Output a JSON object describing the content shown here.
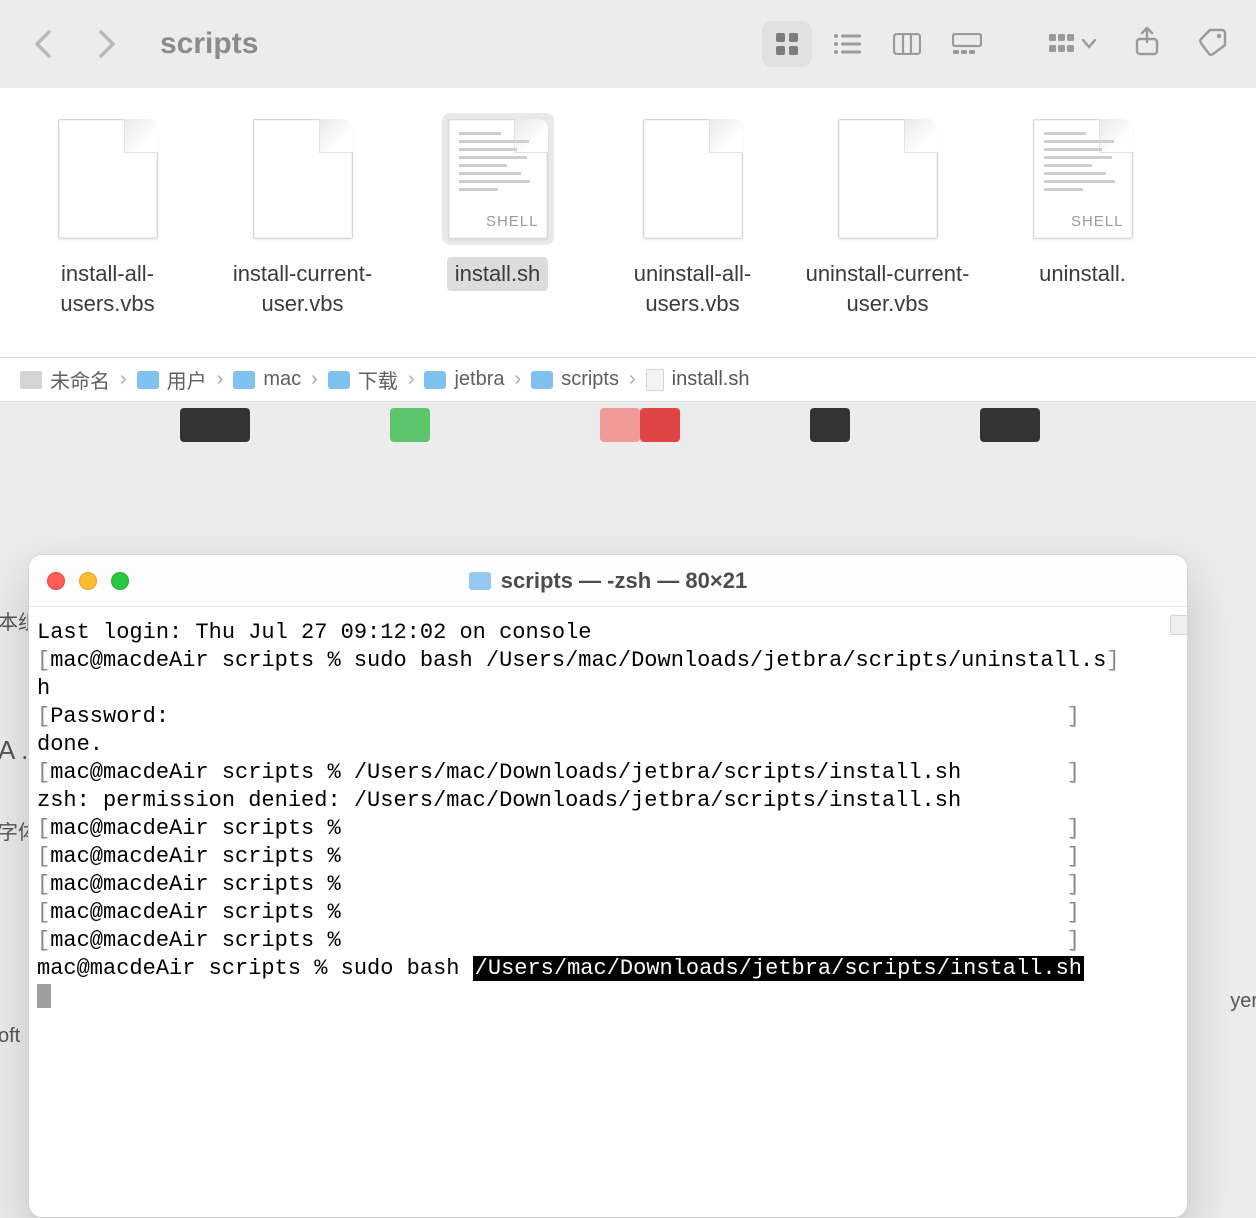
{
  "finder": {
    "title": "scripts",
    "files": [
      {
        "name": "install-all-users.vbs",
        "kind": "plain",
        "selected": false
      },
      {
        "name": "install-current-user.vbs",
        "kind": "plain",
        "selected": false
      },
      {
        "name": "install.sh",
        "kind": "shell",
        "selected": true,
        "tag": "SHELL"
      },
      {
        "name": "uninstall-all-users.vbs",
        "kind": "plain",
        "selected": false
      },
      {
        "name": "uninstall-current-user.vbs",
        "kind": "plain",
        "selected": false
      },
      {
        "name": "uninstall.",
        "kind": "shell",
        "selected": false,
        "tag": "SHELL"
      }
    ],
    "path": [
      {
        "icon": "disk",
        "label": "未命名"
      },
      {
        "icon": "folder",
        "label": "用户"
      },
      {
        "icon": "folder",
        "label": "mac"
      },
      {
        "icon": "folder",
        "label": "下载"
      },
      {
        "icon": "folder",
        "label": "jetbra"
      },
      {
        "icon": "folder",
        "label": "scripts"
      },
      {
        "icon": "file",
        "label": "install.sh"
      }
    ]
  },
  "terminal": {
    "title": "scripts — -zsh — 80×21",
    "lines": [
      {
        "plain": "Last login: Thu Jul 27 09:12:02 on console"
      },
      {
        "br": true,
        "text": "mac@macdeAir scripts % sudo bash /Users/mac/Downloads/jetbra/scripts/uninstall.s"
      },
      {
        "plain": "h"
      },
      {
        "br": true,
        "text": "Password:"
      },
      {
        "plain": "done."
      },
      {
        "br": true,
        "text": "mac@macdeAir scripts % /Users/mac/Downloads/jetbra/scripts/install.sh"
      },
      {
        "plain": "zsh: permission denied: /Users/mac/Downloads/jetbra/scripts/install.sh"
      },
      {
        "br": true,
        "text": "mac@macdeAir scripts % "
      },
      {
        "br": true,
        "text": "mac@macdeAir scripts % "
      },
      {
        "br": true,
        "text": "mac@macdeAir scripts % "
      },
      {
        "br": true,
        "text": "mac@macdeAir scripts % "
      },
      {
        "br": true,
        "text": "mac@macdeAir scripts % "
      },
      {
        "cmd": true,
        "pre": "mac@macdeAir scripts % sudo bash ",
        "hl": "/Users/mac/Downloads/jetbra/scripts/install.sh"
      }
    ]
  },
  "peek": {
    "l1": "本组",
    "l2": "A .",
    "l3": "字体",
    "l4": "oft",
    "r1": "yer"
  }
}
